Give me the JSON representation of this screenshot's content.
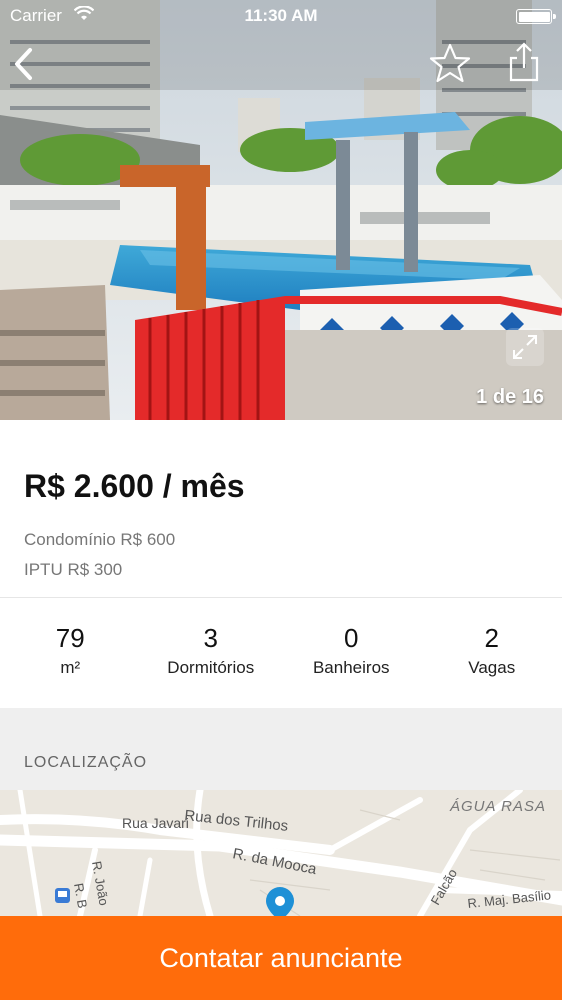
{
  "status_bar": {
    "carrier": "Carrier",
    "time": "11:30 AM"
  },
  "gallery": {
    "counter": "1 de 16",
    "icons": [
      "chevron-left-icon",
      "star-outline-icon",
      "share-icon",
      "expand-icon"
    ]
  },
  "listing": {
    "price": "R$ 2.600 / mês",
    "condominio": "Condomínio R$ 600",
    "iptu": "IPTU R$ 300"
  },
  "features": [
    {
      "value": "79",
      "label": "m²"
    },
    {
      "value": "3",
      "label": "Dormitórios"
    },
    {
      "value": "0",
      "label": "Banheiros"
    },
    {
      "value": "2",
      "label": "Vagas"
    }
  ],
  "location": {
    "header": "LOCALIZAÇÃO",
    "map_labels": {
      "rua_trilhos": "Rua dos Trilhos",
      "agua_rasa": "ÁGUA RASA",
      "rua_javari": "Rua Javari",
      "r_mooca": "R. da Mooca",
      "r_joao": "R. João",
      "r_b": "R. B",
      "falcao": "Falcão",
      "maj_basilio": "R. Maj. Basílio"
    }
  },
  "cta": {
    "label": "Contatar anunciante"
  },
  "colors": {
    "accent": "#ff6c0b",
    "map_pin": "#1e90d6"
  }
}
